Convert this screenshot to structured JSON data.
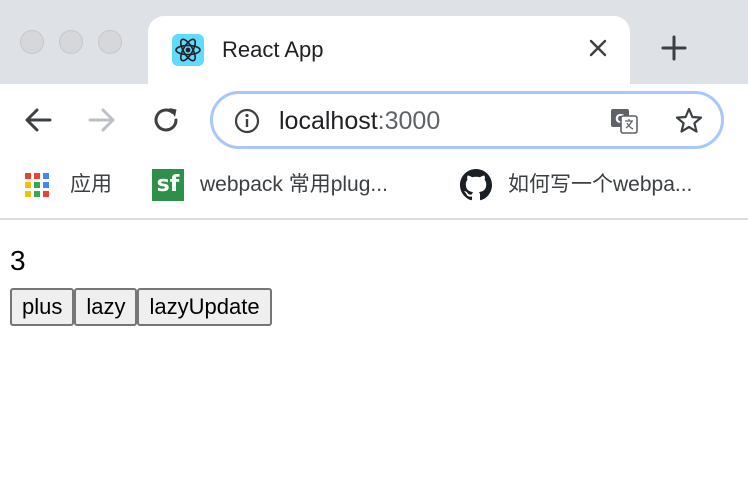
{
  "browser": {
    "tab": {
      "title": "React App",
      "favicon": "react-logo-icon"
    },
    "address_bar": {
      "host": "localhost",
      "port": ":3000"
    },
    "bookmarks": [
      {
        "label": "应用",
        "icon": "apps-grid-icon"
      },
      {
        "label": "webpack 常用plug...",
        "icon": "sf-logo-icon"
      },
      {
        "label": "如何写一个webpa...",
        "icon": "github-icon"
      }
    ],
    "colors": {
      "tab_strip": "#dee1e6",
      "omnibox_border": "#a8c7fa",
      "react": "#61dafb",
      "sf_green": "#2c8f4a"
    }
  },
  "page": {
    "count": "3",
    "buttons": [
      {
        "label": "plus"
      },
      {
        "label": "lazy"
      },
      {
        "label": "lazyUpdate"
      }
    ]
  }
}
